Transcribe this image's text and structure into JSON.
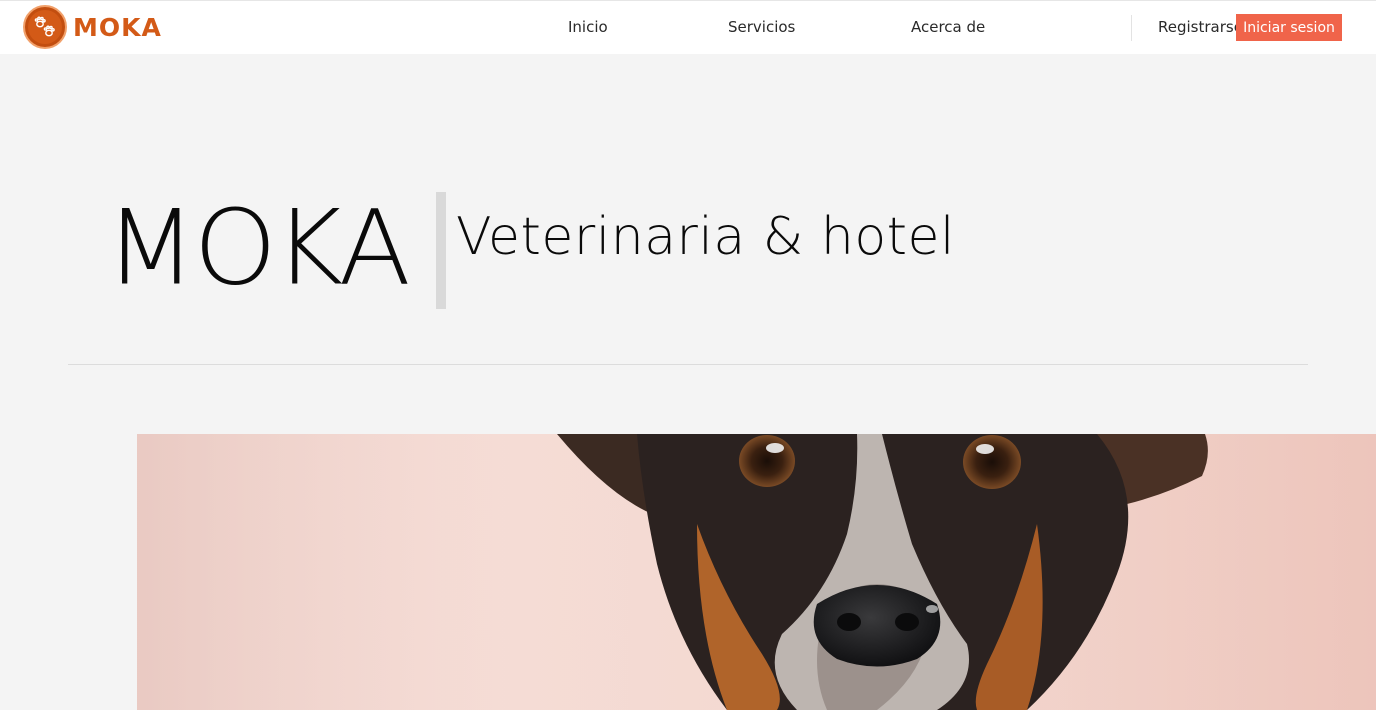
{
  "brand": {
    "name": "MOKA",
    "color": "#d35a17",
    "logo_icon": "paws-icon"
  },
  "nav": {
    "items": [
      {
        "label": "Inicio"
      },
      {
        "label": "Servicios"
      },
      {
        "label": "Acerca de"
      }
    ],
    "register_label": "Registrarse",
    "login_label": "Iniciar sesion",
    "login_color": "#f0644a"
  },
  "hero": {
    "title": "MOKA",
    "subtitle": "Veterinaria & hotel"
  },
  "photo": {
    "subject": "dog-photo",
    "background_color": "#f3d7cf"
  }
}
